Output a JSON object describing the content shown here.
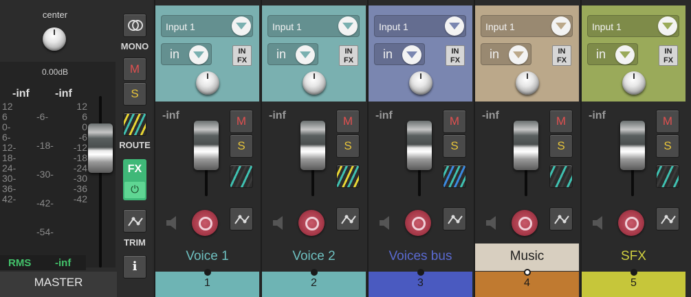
{
  "master": {
    "pan_label": "center",
    "volume_db": "0.00dB",
    "peak_left": "-inf",
    "peak_right": "-inf",
    "scale_left": [
      "12",
      "6",
      "0-",
      "6-",
      "12-",
      "18-",
      "24-",
      "30-",
      "36-",
      "42-"
    ],
    "scale_right": [
      "12",
      "6",
      "0",
      "-6",
      "-12",
      "-18",
      "-24",
      "-30",
      "-36",
      "-42"
    ],
    "scale_center": [
      "-6-",
      "-18-",
      "-30-",
      "-42-",
      "-54-"
    ],
    "rms_label": "RMS",
    "rms_value": "-inf",
    "name": "MASTER"
  },
  "toolstrip": {
    "mono_label": "MONO",
    "mute_label": "M",
    "solo_label": "S",
    "route_label": "ROUTE",
    "fx_label": "FX",
    "power_icon": "⏻",
    "trim_label": "TRIM",
    "info_label": "i"
  },
  "tracks": [
    {
      "input": "Input 1",
      "in_label": "in",
      "infx": "IN FX",
      "vol": "-inf",
      "mute": "M",
      "solo": "S",
      "name": "Voice 1",
      "number": "1",
      "top_color": "#7ab0b0",
      "name_color": "#6ec0c0",
      "num_bg": "#6eb4b4",
      "arrow": "#7ab0b0",
      "route_colors": [
        "#3a3a3a",
        "#3fc0b0"
      ]
    },
    {
      "input": "Input 1",
      "in_label": "in",
      "infx": "IN FX",
      "vol": "-inf",
      "mute": "M",
      "solo": "S",
      "name": "Voice 2",
      "number": "2",
      "top_color": "#7ab0b0",
      "name_color": "#6ec0c0",
      "num_bg": "#6eb4b4",
      "arrow": "#7ab0b0",
      "route_colors": [
        "#e8d634",
        "#3fc0b0"
      ]
    },
    {
      "input": "Input 1",
      "in_label": "in",
      "infx": "IN FX",
      "vol": "-inf",
      "mute": "M",
      "solo": "S",
      "name": "Voices bus",
      "number": "3",
      "top_color": "#7a86b0",
      "name_color": "#5a6ad0",
      "num_bg": "#4a5ac0",
      "arrow": "#7a86b0",
      "route_colors": [
        "#3fc0b0",
        "#3a8ae0"
      ]
    },
    {
      "input": "Input 1",
      "in_label": "in",
      "infx": "IN FX",
      "vol": "-inf",
      "mute": "M",
      "solo": "S",
      "name": "Music",
      "number": "4",
      "top_color": "#bba88a",
      "name_color": "#1e1e1e",
      "num_bg": "#c07a30",
      "arrow": "#bba88a",
      "route_colors": [
        "#3fc0b0",
        "#3a3a3a"
      ]
    },
    {
      "input": "Input 1",
      "in_label": "in",
      "infx": "IN FX",
      "vol": "-inf",
      "mute": "M",
      "solo": "S",
      "name": "SFX",
      "number": "5",
      "top_color": "#9aaa5a",
      "name_color": "#d0d040",
      "num_bg": "#c6c63a",
      "arrow": "#9aaa5a",
      "route_colors": [
        "#3fc0b0",
        "#3a3a3a"
      ]
    }
  ]
}
